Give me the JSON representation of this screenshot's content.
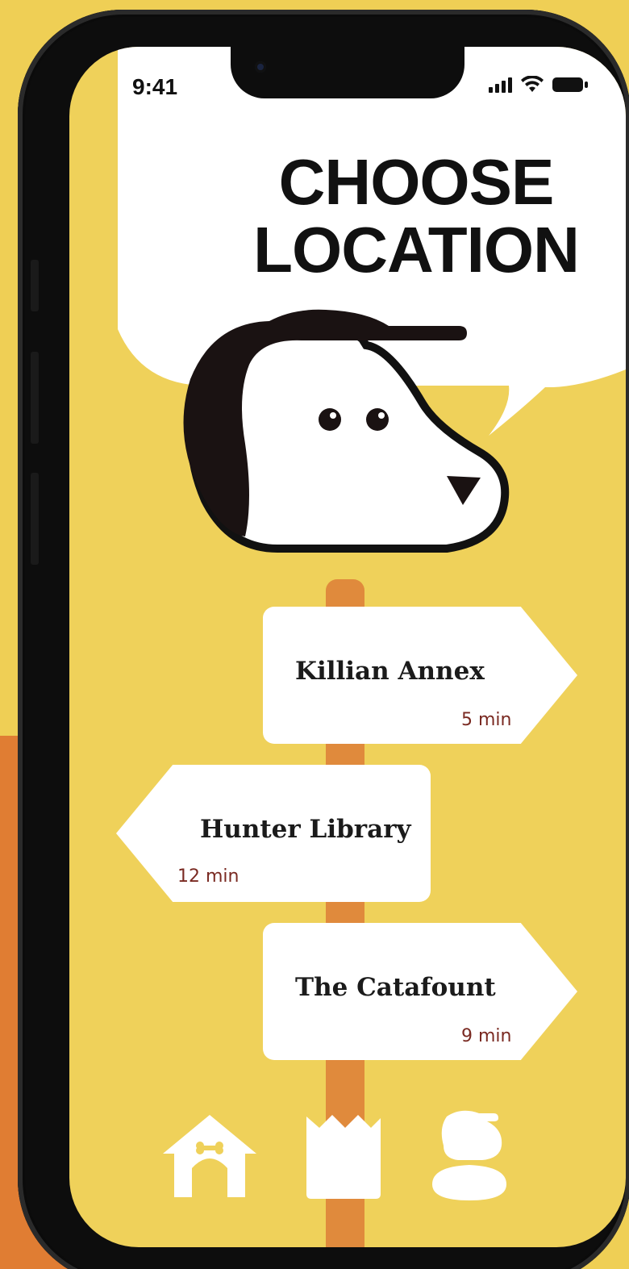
{
  "status_bar": {
    "time": "9:41"
  },
  "header": {
    "title": "CHOOSE\nLOCATION"
  },
  "locations": [
    {
      "name": "Killian Annex",
      "time": "5 min",
      "direction": "right"
    },
    {
      "name": "Hunter Library",
      "time": "12 min",
      "direction": "left"
    },
    {
      "name": "The Catafount",
      "time": "9 min",
      "direction": "right"
    }
  ],
  "nav": {
    "items": [
      {
        "icon": "doghouse-icon"
      },
      {
        "icon": "bag-icon"
      },
      {
        "icon": "profile-icon"
      }
    ]
  },
  "colors": {
    "background": "#EFD15A",
    "sign": "#FFFFFF",
    "pole": "#E08A3C",
    "time_text": "#7A2A22",
    "accent_orange": "#E07D33"
  }
}
